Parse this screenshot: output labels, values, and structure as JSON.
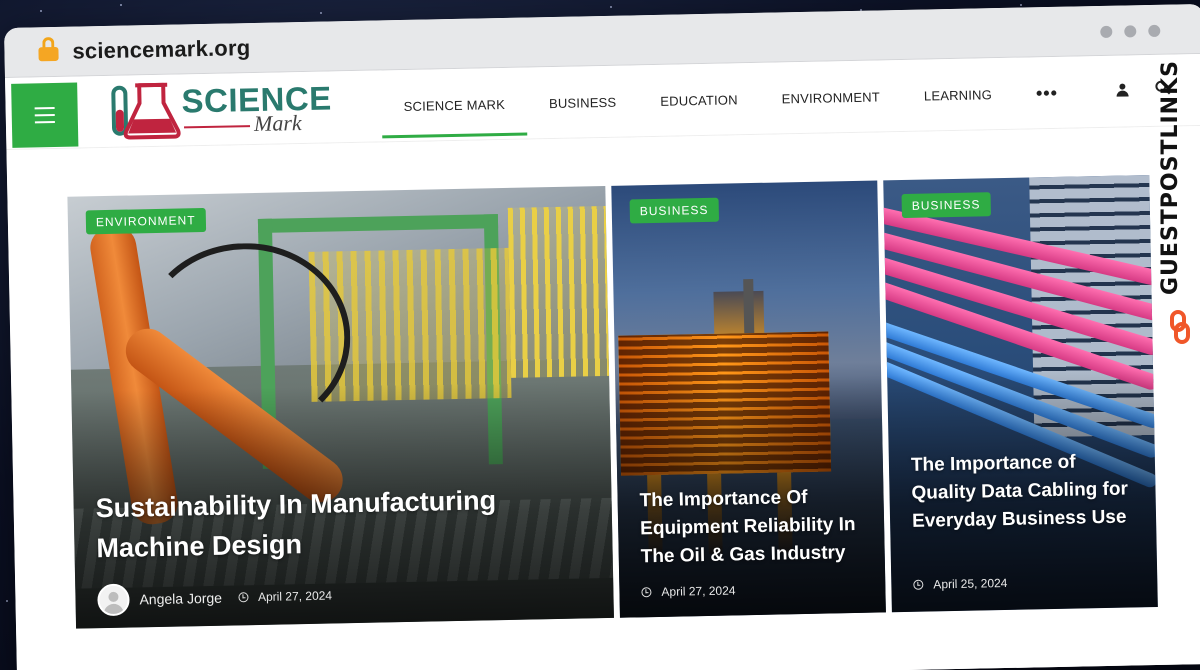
{
  "browser": {
    "url": "sciencemark.org"
  },
  "site": {
    "logo_top": "SCIENCE",
    "logo_bottom": "Mark"
  },
  "nav": {
    "items": [
      "SCIENCE MARK",
      "BUSINESS",
      "EDUCATION",
      "ENVIRONMENT",
      "LEARNING"
    ],
    "more": "•••",
    "active_index": 0
  },
  "watermark": {
    "text": "GUESTPOSTLINKS"
  },
  "cards": [
    {
      "category": "ENVIRONMENT",
      "title": "Sustainability In Manufacturing Machine Design",
      "author": "Angela Jorge",
      "date": "April 27, 2024"
    },
    {
      "category": "BUSINESS",
      "title": "The Importance Of Equipment Reliability In The Oil & Gas Industry",
      "date": "April 27, 2024"
    },
    {
      "category": "BUSINESS",
      "title": "The Importance of Quality Data Cabling for Everyday Business Use",
      "date": "April 25, 2024"
    }
  ],
  "colors": {
    "accent_green": "#2fac44",
    "logo_teal": "#2a7a6e",
    "logo_red": "#c0243f",
    "lock_orange": "#f5a623",
    "watermark_orange": "#f0572a"
  },
  "icons": {
    "menu": "hamburger-icon",
    "user": "user-icon",
    "search": "search-icon",
    "lock": "lock-icon",
    "clock": "clock-icon"
  }
}
